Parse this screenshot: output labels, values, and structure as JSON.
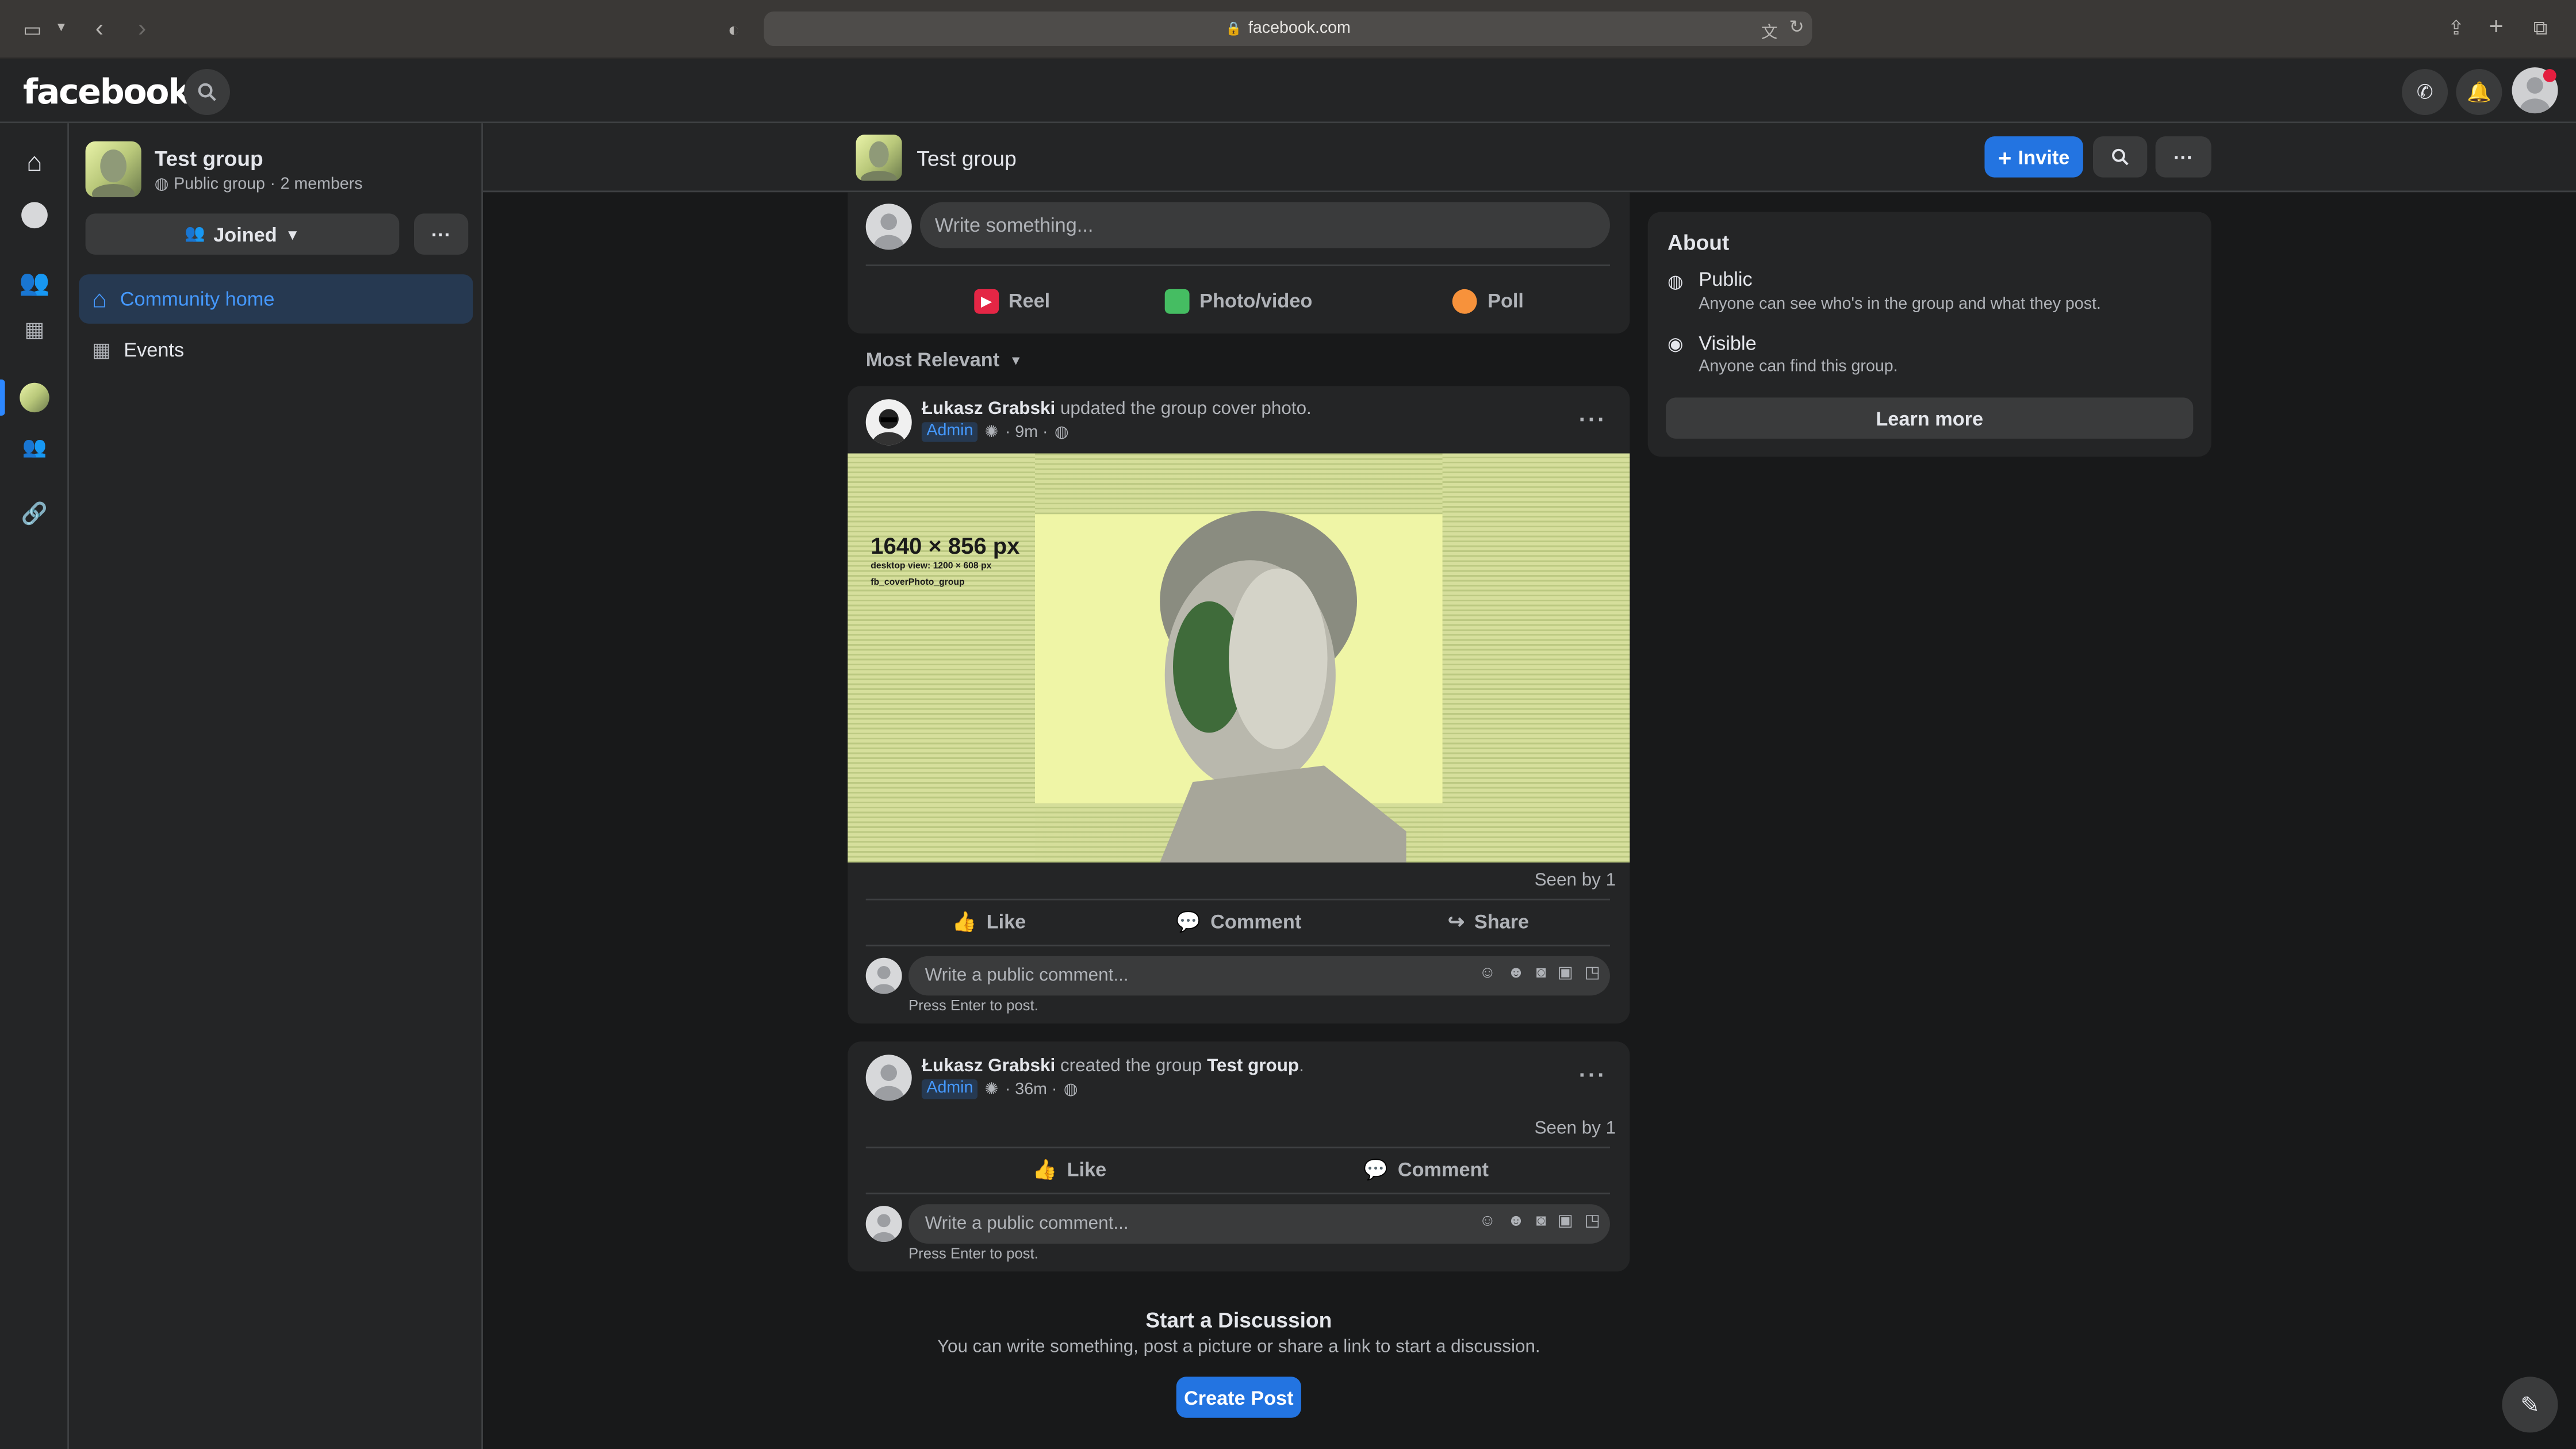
{
  "browser": {
    "url": "facebook.com"
  },
  "header": {
    "logo": "facebook"
  },
  "group": {
    "name": "Test group",
    "privacy": "Public group",
    "members": "2 members",
    "joined_label": "Joined",
    "more_label": "···"
  },
  "sidebar": {
    "items": [
      {
        "label": "Community home",
        "active": true
      },
      {
        "label": "Events",
        "active": false
      }
    ]
  },
  "groupbar": {
    "title": "Test group",
    "invite_label": "Invite"
  },
  "composer": {
    "placeholder": "Write something...",
    "actions": [
      {
        "label": "Reel",
        "icon": "reel-icon"
      },
      {
        "label": "Photo/video",
        "icon": "photo-icon"
      },
      {
        "label": "Poll",
        "icon": "poll-icon"
      }
    ]
  },
  "sort": {
    "label": "Most Relevant"
  },
  "posts": [
    {
      "author": "Łukasz Grabski",
      "action": " updated the group cover photo.",
      "badge": "Admin",
      "time": "· 9m ·",
      "seen": "Seen by 1",
      "cover": {
        "size": "1640 × 856 px",
        "desktop": "desktop view: 1200 × 608 px",
        "name": "fb_coverPhoto_group"
      },
      "like": "Like",
      "comment": "Comment",
      "share": "Share",
      "comment_placeholder": "Write a public comment...",
      "hint": "Press Enter to post."
    },
    {
      "author": "Łukasz Grabski",
      "action_prefix": " created the group ",
      "action_target": "Test group",
      "action_suffix": ".",
      "badge": "Admin",
      "time": "· 36m ·",
      "seen": "Seen by 1",
      "like": "Like",
      "comment": "Comment",
      "comment_placeholder": "Write a public comment...",
      "hint": "Press Enter to post."
    }
  ],
  "about": {
    "title": "About",
    "public_title": "Public",
    "public_desc": "Anyone can see who's in the group and what they post.",
    "visible_title": "Visible",
    "visible_desc": "Anyone can find this group.",
    "learn_more": "Learn more"
  },
  "discussion": {
    "title": "Start a Discussion",
    "desc": "You can write something, post a picture or share a link to start a discussion.",
    "button": "Create Post"
  },
  "colors": {
    "accent": "#2374e1",
    "background": "#18191a",
    "surface": "#242526"
  }
}
